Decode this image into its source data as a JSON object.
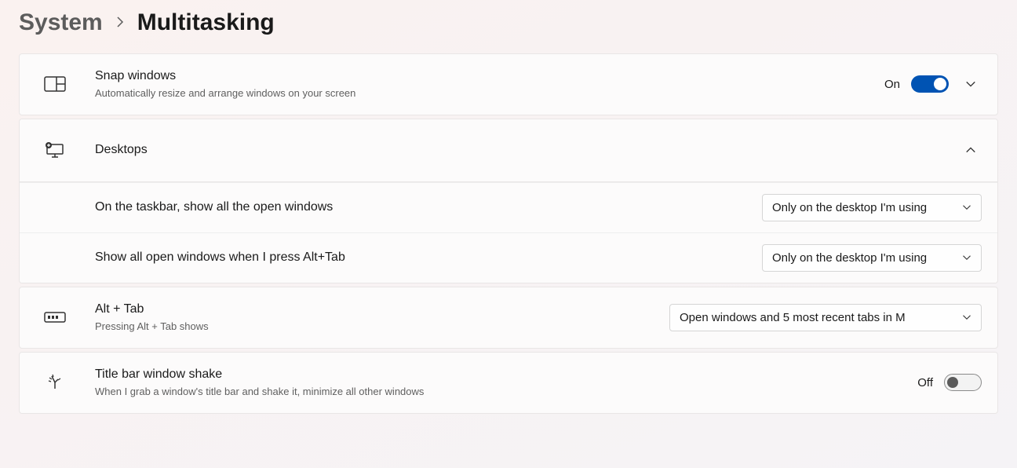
{
  "breadcrumb": {
    "parent": "System",
    "current": "Multitasking"
  },
  "snap": {
    "title": "Snap windows",
    "subtitle": "Automatically resize and arrange windows on your screen",
    "state_label": "On",
    "state_on": true
  },
  "desktops": {
    "title": "Desktops",
    "expanded": true,
    "taskbar": {
      "label": "On the taskbar, show all the open windows",
      "value": "Only on the desktop I'm using"
    },
    "alttab": {
      "label": "Show all open windows when I press Alt+Tab",
      "value": "Only on the desktop I'm using"
    }
  },
  "alt_tab": {
    "title": "Alt + Tab",
    "subtitle": "Pressing Alt + Tab shows",
    "value": "Open windows and 5 most recent tabs in M"
  },
  "shake": {
    "title": "Title bar window shake",
    "subtitle": "When I grab a window's title bar and shake it, minimize all other windows",
    "state_label": "Off",
    "state_on": false
  }
}
